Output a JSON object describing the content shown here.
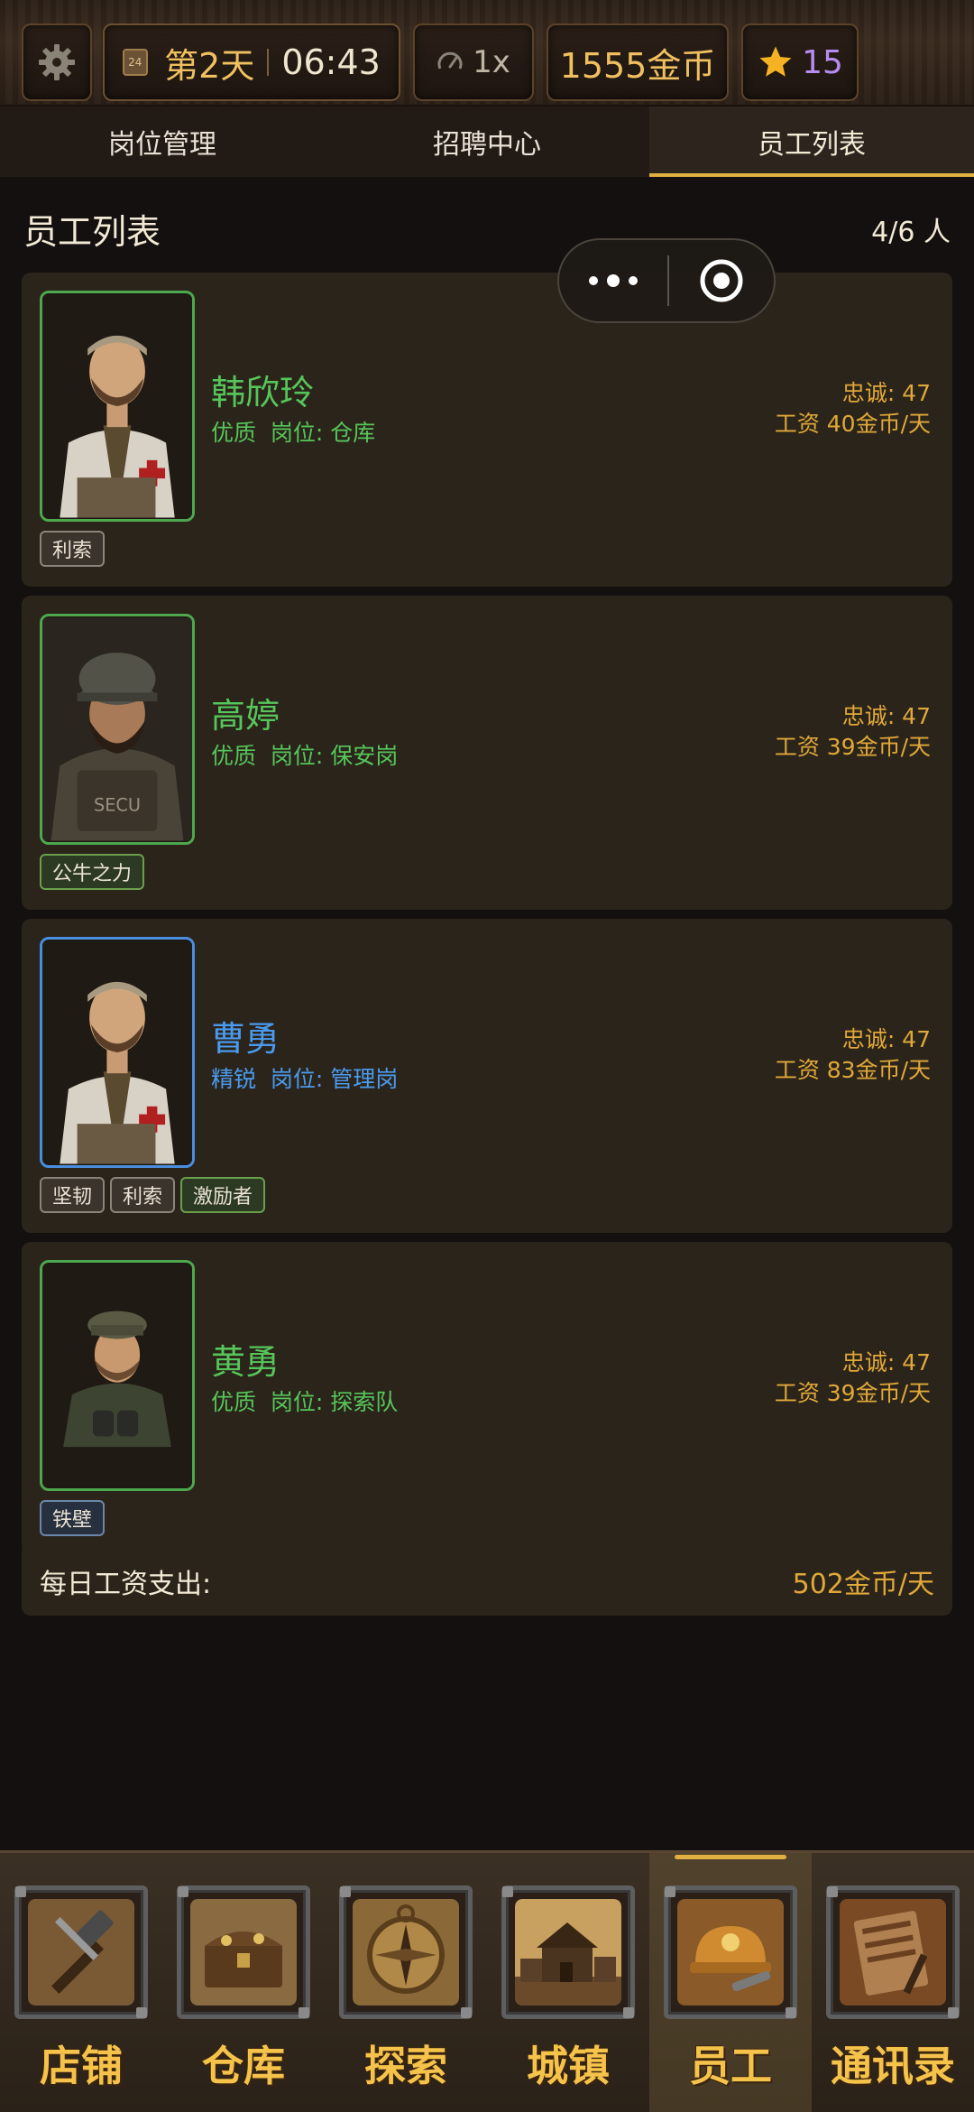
{
  "hud": {
    "day": "第2天",
    "time": "06:43",
    "speed": "1x",
    "gold": "1555金币",
    "stars": "15"
  },
  "tabs": [
    {
      "label": "岗位管理"
    },
    {
      "label": "招聘中心"
    },
    {
      "label": "员工列表"
    }
  ],
  "section": {
    "title": "员工列表",
    "count": "4/6 人"
  },
  "employees": [
    {
      "name": "韩欣玲",
      "quality": "优质",
      "position": "岗位: 仓库",
      "loyalty": "忠诚: 47",
      "wage": "工资 40金币/天",
      "tags": [
        "利索"
      ]
    },
    {
      "name": "高婷",
      "quality": "优质",
      "position": "岗位: 保安岗",
      "loyalty": "忠诚: 47",
      "wage": "工资 39金币/天",
      "tags": [
        "公牛之力"
      ]
    },
    {
      "name": "曹勇",
      "quality": "精锐",
      "position": "岗位: 管理岗",
      "loyalty": "忠诚: 47",
      "wage": "工资 83金币/天",
      "tags": [
        "坚韧",
        "利索",
        "激励者"
      ]
    },
    {
      "name": "黄勇",
      "quality": "优质",
      "position": "岗位: 探索队",
      "loyalty": "忠诚: 47",
      "wage": "工资 39金币/天",
      "tags": [
        "铁壁"
      ]
    }
  ],
  "summary": {
    "label": "每日工资支出:",
    "value": "502金币/天"
  },
  "bottom_nav": [
    {
      "label": "店铺",
      "icon": "hammer-icon"
    },
    {
      "label": "仓库",
      "icon": "chest-icon"
    },
    {
      "label": "探索",
      "icon": "compass-icon"
    },
    {
      "label": "城镇",
      "icon": "town-icon"
    },
    {
      "label": "员工",
      "icon": "helmet-icon"
    },
    {
      "label": "通讯录",
      "icon": "book-icon"
    }
  ],
  "colors": {
    "quality_good": "#56c65a",
    "quality_elite": "#4a9bef",
    "accent_gold": "#e0a838"
  }
}
